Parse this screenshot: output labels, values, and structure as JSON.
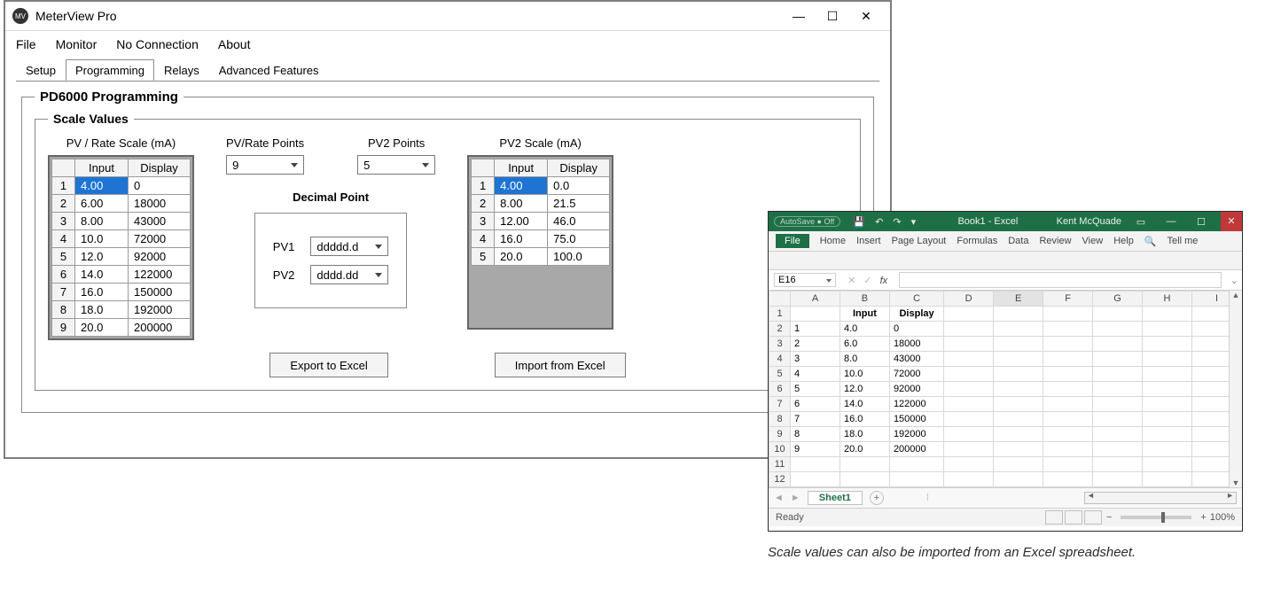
{
  "meterview": {
    "title": "MeterView Pro",
    "menu": {
      "file": "File",
      "monitor": "Monitor",
      "noconn": "No Connection",
      "about": "About"
    },
    "tabs": {
      "setup": "Setup",
      "programming": "Programming",
      "relays": "Relays",
      "advanced": "Advanced Features"
    },
    "group_title": "PD6000 Programming",
    "scale_title": "Scale Values",
    "labels": {
      "pv_scale": "PV / Rate Scale (mA)",
      "pv_points": "PV/Rate Points",
      "pv2_points": "PV2 Points",
      "pv2_scale": "PV2 Scale (mA)",
      "decimal_point": "Decimal Point",
      "pv1": "PV1",
      "pv2": "PV2",
      "input": "Input",
      "display": "Display",
      "export": "Export to Excel",
      "import": "Import from Excel"
    },
    "pv_points_val": "9",
    "pv2_points_val": "5",
    "pv1_fmt": "ddddd.d",
    "pv2_fmt": "dddd.dd",
    "pv_table": [
      {
        "n": "1",
        "in": "4.00",
        "out": "0"
      },
      {
        "n": "2",
        "in": "6.00",
        "out": "18000"
      },
      {
        "n": "3",
        "in": "8.00",
        "out": "43000"
      },
      {
        "n": "4",
        "in": "10.0",
        "out": "72000"
      },
      {
        "n": "5",
        "in": "12.0",
        "out": "92000"
      },
      {
        "n": "6",
        "in": "14.0",
        "out": "122000"
      },
      {
        "n": "7",
        "in": "16.0",
        "out": "150000"
      },
      {
        "n": "8",
        "in": "18.0",
        "out": "192000"
      },
      {
        "n": "9",
        "in": "20.0",
        "out": "200000"
      }
    ],
    "pv2_table": [
      {
        "n": "1",
        "in": "4.00",
        "out": "0.0"
      },
      {
        "n": "2",
        "in": "8.00",
        "out": "21.5"
      },
      {
        "n": "3",
        "in": "12.00",
        "out": "46.0"
      },
      {
        "n": "4",
        "in": "16.0",
        "out": "75.0"
      },
      {
        "n": "5",
        "in": "20.0",
        "out": "100.0"
      }
    ]
  },
  "excel": {
    "autosave": "AutoSave ● Off",
    "doc": "Book1 - Excel",
    "user": "Kent McQuade",
    "tabs": {
      "file": "File",
      "home": "Home",
      "insert": "Insert",
      "pagelayout": "Page Layout",
      "formulas": "Formulas",
      "data": "Data",
      "review": "Review",
      "view": "View",
      "help": "Help",
      "tellme": "Tell me"
    },
    "namebox": "E16",
    "fx": "fx",
    "cols": [
      "A",
      "B",
      "C",
      "D",
      "E",
      "F",
      "G",
      "H",
      "I"
    ],
    "header_row": {
      "B": "Input",
      "C": "Display"
    },
    "rows": [
      {
        "r": "1"
      },
      {
        "r": "2",
        "A": "1",
        "B": "4.0",
        "C": "0"
      },
      {
        "r": "3",
        "A": "2",
        "B": "6.0",
        "C": "18000"
      },
      {
        "r": "4",
        "A": "3",
        "B": "8.0",
        "C": "43000"
      },
      {
        "r": "5",
        "A": "4",
        "B": "10.0",
        "C": "72000"
      },
      {
        "r": "6",
        "A": "5",
        "B": "12.0",
        "C": "92000"
      },
      {
        "r": "7",
        "A": "6",
        "B": "14.0",
        "C": "122000"
      },
      {
        "r": "8",
        "A": "7",
        "B": "16.0",
        "C": "150000"
      },
      {
        "r": "9",
        "A": "8",
        "B": "18.0",
        "C": "192000"
      },
      {
        "r": "10",
        "A": "9",
        "B": "20.0",
        "C": "200000"
      },
      {
        "r": "11"
      },
      {
        "r": "12"
      }
    ],
    "sheet": "Sheet1",
    "status": "Ready",
    "zoom": "100%"
  },
  "caption": "Scale values can also be imported from an Excel spreadsheet."
}
